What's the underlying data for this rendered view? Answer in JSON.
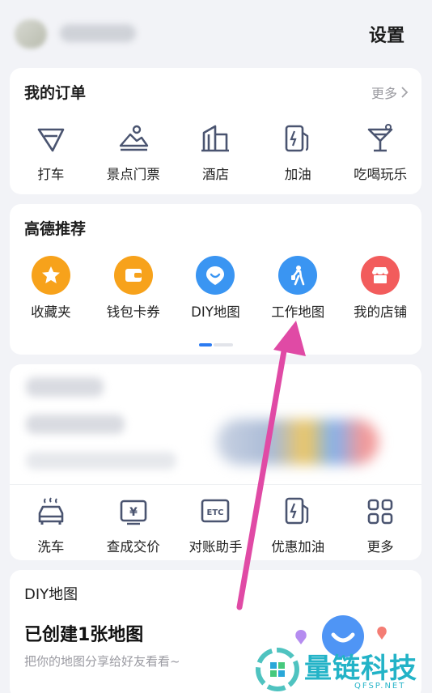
{
  "header": {
    "settings_label": "设置"
  },
  "orders": {
    "title": "我的订单",
    "more_label": "更多",
    "items": [
      {
        "label": "打车",
        "icon": "taxi-icon"
      },
      {
        "label": "景点门票",
        "icon": "scenic-ticket-icon"
      },
      {
        "label": "酒店",
        "icon": "hotel-icon"
      },
      {
        "label": "加油",
        "icon": "fuel-icon"
      },
      {
        "label": "吃喝玩乐",
        "icon": "cocktail-icon"
      }
    ]
  },
  "recommend": {
    "title": "高德推荐",
    "items": [
      {
        "label": "收藏夹",
        "icon": "star-icon",
        "color": "#f7a21b"
      },
      {
        "label": "钱包卡券",
        "icon": "wallet-icon",
        "color": "#f7a21b"
      },
      {
        "label": "DIY地图",
        "icon": "diy-map-icon",
        "color": "#3a95f2"
      },
      {
        "label": "工作地图",
        "icon": "work-map-icon",
        "color": "#3a95f2"
      },
      {
        "label": "我的店铺",
        "icon": "shop-icon",
        "color": "#f25c5c"
      }
    ]
  },
  "car": {
    "items": [
      {
        "label": "洗车",
        "icon": "car-wash-icon"
      },
      {
        "label": "查成交价",
        "icon": "price-check-icon"
      },
      {
        "label": "对账助手",
        "icon": "etc-icon"
      },
      {
        "label": "优惠加油",
        "icon": "fuel-discount-icon"
      },
      {
        "label": "更多",
        "icon": "grid-icon"
      }
    ]
  },
  "diy": {
    "title": "DIY地图",
    "headline": "已创建1张地图",
    "subtitle": "把你的地图分享给好友看看~"
  },
  "watermark": {
    "text": "量链科技",
    "url": "QFSP.NET"
  },
  "colors": {
    "accent": "#2c7bf1",
    "annotation_arrow": "#e04aa5",
    "icon_stroke": "#4a5470"
  }
}
